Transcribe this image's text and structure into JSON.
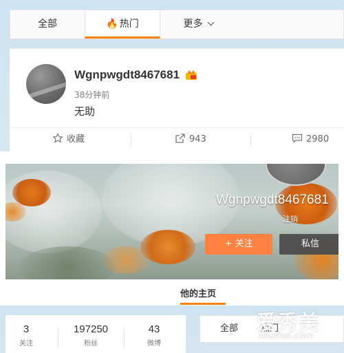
{
  "feed_tabs": {
    "all_label": "全部",
    "hot_label": "热门",
    "more_label": "更多"
  },
  "post": {
    "username": "Wgnpwgdt8467681",
    "timestamp": "38分钟前",
    "text": "无助",
    "actions": {
      "favorite_label": "收藏",
      "share_count": "943",
      "comment_count": "2980"
    }
  },
  "profile": {
    "name": "Wgnpwgdt8467681",
    "status_label": "注销",
    "follow_label": "+ 关注",
    "message_label": "私信",
    "home_tab_label": "他的主页"
  },
  "stats": [
    {
      "value": "3",
      "label": "关注"
    },
    {
      "value": "197250",
      "label": "粉丝"
    },
    {
      "value": "43",
      "label": "微博"
    }
  ],
  "bottom_tabs": {
    "all_label": "全部",
    "hot_label": "热门"
  },
  "watermark": {
    "logo": "爱秀美",
    "url": "ixiumei.com"
  },
  "colors": {
    "accent": "#ff8200",
    "follow_button": "#ff8140",
    "message_button": "#4a4a4a",
    "background": "#cfe3f0"
  }
}
